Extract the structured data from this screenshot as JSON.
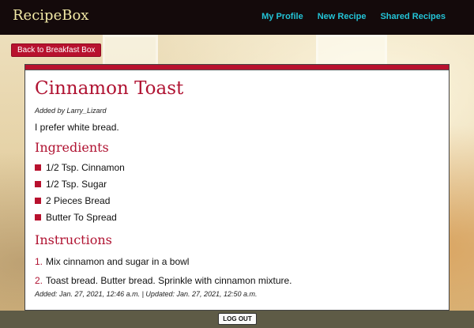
{
  "navbar": {
    "brand": "RecipeBox",
    "links": [
      "My Profile",
      "New Recipe",
      "Shared Recipes"
    ]
  },
  "back_button": "Back to Breakfast Box",
  "recipe": {
    "title": "Cinnamon Toast",
    "added_by": "Added by Larry_Lizard",
    "description": "I prefer white bread.",
    "ingredients_heading": "Ingredients",
    "ingredients": [
      "1/2 Tsp. Cinnamon",
      "1/2 Tsp. Sugar",
      "2 Pieces Bread",
      "Butter To Spread"
    ],
    "instructions_heading": "Instructions",
    "instructions": [
      {
        "num": "1.",
        "text": "Mix cinnamon and sugar in a bowl"
      },
      {
        "num": "2.",
        "text": "Toast bread. Butter bread. Sprinkle with cinnamon mixture."
      }
    ],
    "meta": "Added: Jan. 27, 2021, 12:46 a.m. | Updated: Jan. 27, 2021, 12:50 a.m."
  },
  "logout_label": "LOG OUT",
  "colors": {
    "accent": "#b8112e",
    "nav_bg": "#140a0b",
    "nav_link": "#23c3d6",
    "brand": "#f2e9a6"
  }
}
